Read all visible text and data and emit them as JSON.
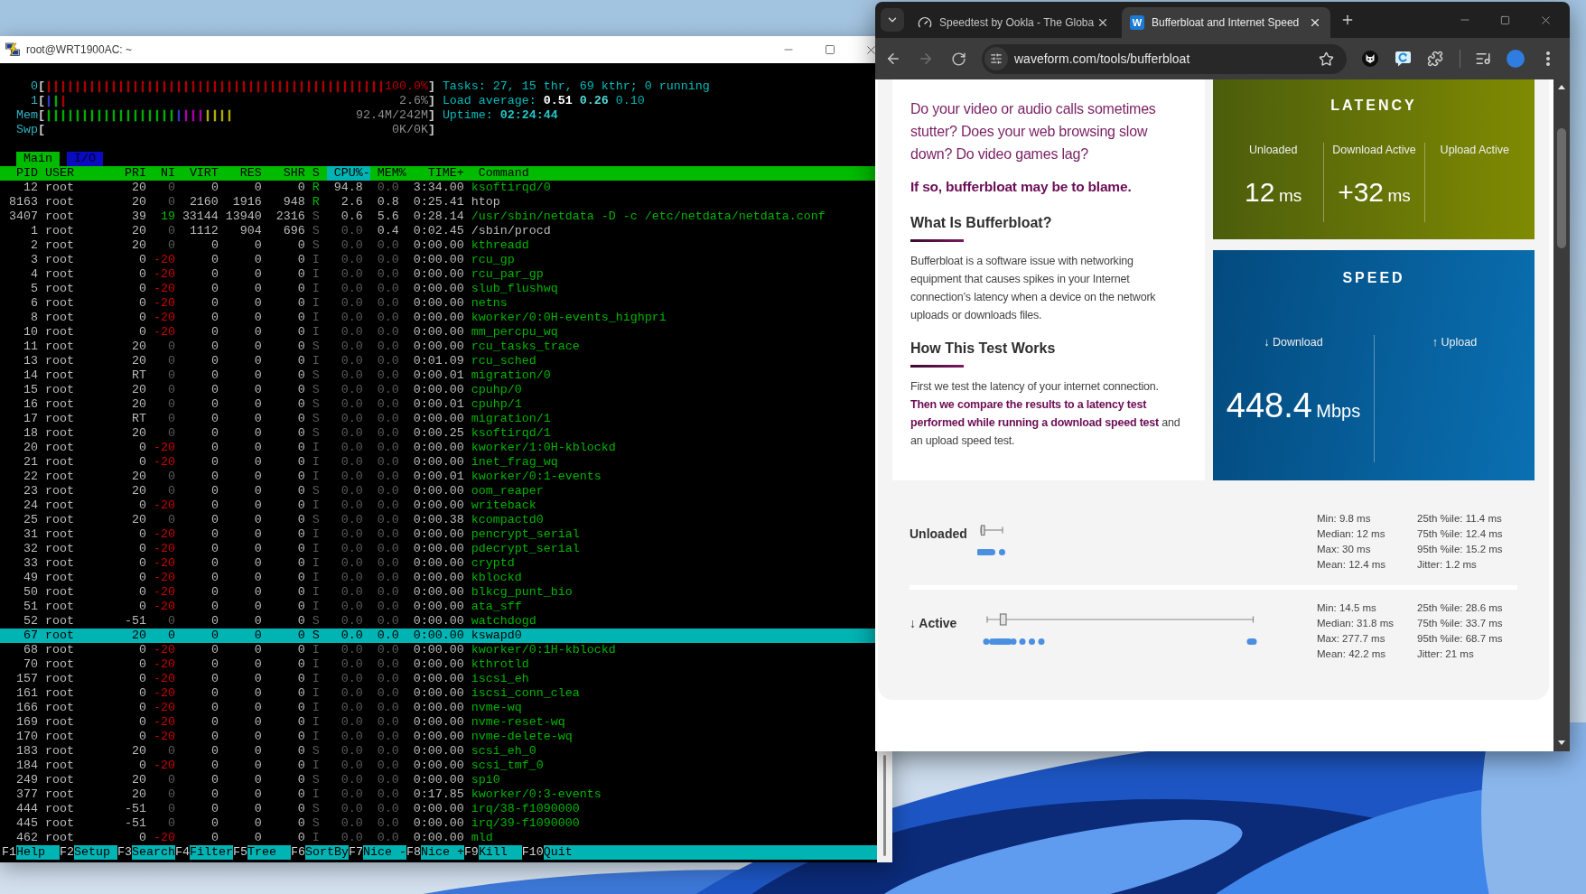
{
  "terminal": {
    "title": "root@WRT1900AC: ~",
    "meters": [
      {
        "label": "0",
        "open": "[",
        "bars": [
          {
            "color": "#bb0000",
            "text": "|||||||||||||||||||||||||||||||||||||||||||||||"
          }
        ],
        "reading": "100.0%",
        "close": "]"
      },
      {
        "label": "1",
        "open": "[",
        "bars": [
          {
            "color": "#3b3bd6",
            "text": "|"
          },
          {
            "color": "#00bb00",
            "text": "|"
          },
          {
            "color": "#bb0000",
            "text": "|"
          }
        ],
        "reading": "2.6%",
        "close": "]"
      },
      {
        "label": "Mem",
        "open": "[",
        "bars": [
          {
            "color": "#00bb00",
            "text": "||||||||||||||||||"
          },
          {
            "color": "#3b3bd6",
            "text": "|"
          },
          {
            "color": "#bb00bb",
            "text": "|||"
          },
          {
            "color": "#bbbb00",
            "text": "||||"
          }
        ],
        "reading": "92.4M/242M",
        "close": "]"
      },
      {
        "label": "Swp",
        "open": "[",
        "reading": "0K/0K",
        "close": "]"
      }
    ],
    "summary": [
      {
        "label": "Tasks:",
        "values": [
          "27, 15 thr, 69 kthr; 0 running"
        ]
      },
      {
        "label": "Load average:",
        "values": [
          "0.51",
          "0.26",
          "0.10"
        ]
      },
      {
        "label": "Uptime:",
        "values": [
          "02:24:44"
        ]
      }
    ],
    "tabs": [
      {
        "label": "Main",
        "selected": true
      },
      {
        "label": "I/O",
        "selected": false
      }
    ],
    "columns": [
      {
        "label": "PID",
        "selected": false
      },
      {
        "label": "USER",
        "selected": false
      },
      {
        "label": "PRI",
        "selected": false
      },
      {
        "label": "NI",
        "selected": false
      },
      {
        "label": "VIRT",
        "selected": false
      },
      {
        "label": "RES",
        "selected": false
      },
      {
        "label": "SHR",
        "selected": false
      },
      {
        "label": "S",
        "selected": false
      },
      {
        "label": "CPU%-",
        "selected": true
      },
      {
        "label": "MEM%",
        "selected": false
      },
      {
        "label": "TIME+",
        "selected": false
      },
      {
        "label": "Command",
        "selected": false
      }
    ],
    "processes": [
      {
        "pid": "12",
        "user": "root",
        "pri": "20",
        "ni": "0",
        "virt": "0",
        "res": "0",
        "shr": "0",
        "state": "R",
        "cpu": "94.8",
        "mem": "0.0",
        "time": "3:34.00",
        "command": "ksoftirqd/0",
        "kind": "thread",
        "running": true,
        "selected": false
      },
      {
        "pid": "8163",
        "user": "root",
        "pri": "20",
        "ni": "0",
        "virt": "2160",
        "res": "1916",
        "shr": "948",
        "state": "R",
        "cpu": "2.6",
        "mem": "0.8",
        "time": "0:25.41",
        "command": "htop",
        "kind": "process",
        "running": true,
        "selected": false
      },
      {
        "pid": "3407",
        "user": "root",
        "pri": "39",
        "ni": "19",
        "virt": "33144",
        "res": "13940",
        "shr": "2316",
        "state": "S",
        "cpu": "0.6",
        "mem": "5.6",
        "time": "0:28.14",
        "command": "/usr/sbin/netdata -D -c /etc/netdata/netdata.conf",
        "kind": "thread",
        "running": false,
        "selected": false
      },
      {
        "pid": "1",
        "user": "root",
        "pri": "20",
        "ni": "0",
        "virt": "1112",
        "res": "904",
        "shr": "696",
        "state": "S",
        "cpu": "0.0",
        "mem": "0.4",
        "time": "0:02.45",
        "command": "/sbin/procd",
        "kind": "process",
        "running": false,
        "selected": false
      },
      {
        "pid": "2",
        "user": "root",
        "pri": "20",
        "ni": "0",
        "virt": "0",
        "res": "0",
        "shr": "0",
        "state": "S",
        "cpu": "0.0",
        "mem": "0.0",
        "time": "0:00.00",
        "command": "kthreadd",
        "kind": "thread",
        "running": false,
        "selected": false
      },
      {
        "pid": "3",
        "user": "root",
        "pri": "0",
        "ni": "-20",
        "virt": "0",
        "res": "0",
        "shr": "0",
        "state": "I",
        "cpu": "0.0",
        "mem": "0.0",
        "time": "0:00.00",
        "command": "rcu_gp",
        "kind": "thread",
        "running": false,
        "selected": false
      },
      {
        "pid": "4",
        "user": "root",
        "pri": "0",
        "ni": "-20",
        "virt": "0",
        "res": "0",
        "shr": "0",
        "state": "I",
        "cpu": "0.0",
        "mem": "0.0",
        "time": "0:00.00",
        "command": "rcu_par_gp",
        "kind": "thread",
        "running": false,
        "selected": false
      },
      {
        "pid": "5",
        "user": "root",
        "pri": "0",
        "ni": "-20",
        "virt": "0",
        "res": "0",
        "shr": "0",
        "state": "I",
        "cpu": "0.0",
        "mem": "0.0",
        "time": "0:00.00",
        "command": "slub_flushwq",
        "kind": "thread",
        "running": false,
        "selected": false
      },
      {
        "pid": "6",
        "user": "root",
        "pri": "0",
        "ni": "-20",
        "virt": "0",
        "res": "0",
        "shr": "0",
        "state": "I",
        "cpu": "0.0",
        "mem": "0.0",
        "time": "0:00.00",
        "command": "netns",
        "kind": "thread",
        "running": false,
        "selected": false
      },
      {
        "pid": "8",
        "user": "root",
        "pri": "0",
        "ni": "-20",
        "virt": "0",
        "res": "0",
        "shr": "0",
        "state": "I",
        "cpu": "0.0",
        "mem": "0.0",
        "time": "0:00.00",
        "command": "kworker/0:0H-events_highpri",
        "kind": "thread",
        "running": false,
        "selected": false
      },
      {
        "pid": "10",
        "user": "root",
        "pri": "0",
        "ni": "-20",
        "virt": "0",
        "res": "0",
        "shr": "0",
        "state": "I",
        "cpu": "0.0",
        "mem": "0.0",
        "time": "0:00.00",
        "command": "mm_percpu_wq",
        "kind": "thread",
        "running": false,
        "selected": false
      },
      {
        "pid": "11",
        "user": "root",
        "pri": "20",
        "ni": "0",
        "virt": "0",
        "res": "0",
        "shr": "0",
        "state": "S",
        "cpu": "0.0",
        "mem": "0.0",
        "time": "0:00.00",
        "command": "rcu_tasks_trace",
        "kind": "thread",
        "running": false,
        "selected": false
      },
      {
        "pid": "13",
        "user": "root",
        "pri": "20",
        "ni": "0",
        "virt": "0",
        "res": "0",
        "shr": "0",
        "state": "I",
        "cpu": "0.0",
        "mem": "0.0",
        "time": "0:01.09",
        "command": "rcu_sched",
        "kind": "thread",
        "running": false,
        "selected": false
      },
      {
        "pid": "14",
        "user": "root",
        "pri": "RT",
        "ni": "0",
        "virt": "0",
        "res": "0",
        "shr": "0",
        "state": "S",
        "cpu": "0.0",
        "mem": "0.0",
        "time": "0:00.01",
        "command": "migration/0",
        "kind": "thread",
        "running": false,
        "selected": false
      },
      {
        "pid": "15",
        "user": "root",
        "pri": "20",
        "ni": "0",
        "virt": "0",
        "res": "0",
        "shr": "0",
        "state": "S",
        "cpu": "0.0",
        "mem": "0.0",
        "time": "0:00.00",
        "command": "cpuhp/0",
        "kind": "thread",
        "running": false,
        "selected": false
      },
      {
        "pid": "16",
        "user": "root",
        "pri": "20",
        "ni": "0",
        "virt": "0",
        "res": "0",
        "shr": "0",
        "state": "S",
        "cpu": "0.0",
        "mem": "0.0",
        "time": "0:00.01",
        "command": "cpuhp/1",
        "kind": "thread",
        "running": false,
        "selected": false
      },
      {
        "pid": "17",
        "user": "root",
        "pri": "RT",
        "ni": "0",
        "virt": "0",
        "res": "0",
        "shr": "0",
        "state": "S",
        "cpu": "0.0",
        "mem": "0.0",
        "time": "0:00.00",
        "command": "migration/1",
        "kind": "thread",
        "running": false,
        "selected": false
      },
      {
        "pid": "18",
        "user": "root",
        "pri": "20",
        "ni": "0",
        "virt": "0",
        "res": "0",
        "shr": "0",
        "state": "S",
        "cpu": "0.0",
        "mem": "0.0",
        "time": "0:00.25",
        "command": "ksoftirqd/1",
        "kind": "thread",
        "running": false,
        "selected": false
      },
      {
        "pid": "20",
        "user": "root",
        "pri": "0",
        "ni": "-20",
        "virt": "0",
        "res": "0",
        "shr": "0",
        "state": "I",
        "cpu": "0.0",
        "mem": "0.0",
        "time": "0:00.00",
        "command": "kworker/1:0H-kblockd",
        "kind": "thread",
        "running": false,
        "selected": false
      },
      {
        "pid": "21",
        "user": "root",
        "pri": "0",
        "ni": "-20",
        "virt": "0",
        "res": "0",
        "shr": "0",
        "state": "I",
        "cpu": "0.0",
        "mem": "0.0",
        "time": "0:00.00",
        "command": "inet_frag_wq",
        "kind": "thread",
        "running": false,
        "selected": false
      },
      {
        "pid": "22",
        "user": "root",
        "pri": "20",
        "ni": "0",
        "virt": "0",
        "res": "0",
        "shr": "0",
        "state": "I",
        "cpu": "0.0",
        "mem": "0.0",
        "time": "0:00.01",
        "command": "kworker/0:1-events",
        "kind": "thread",
        "running": false,
        "selected": false
      },
      {
        "pid": "23",
        "user": "root",
        "pri": "20",
        "ni": "0",
        "virt": "0",
        "res": "0",
        "shr": "0",
        "state": "S",
        "cpu": "0.0",
        "mem": "0.0",
        "time": "0:00.00",
        "command": "oom_reaper",
        "kind": "thread",
        "running": false,
        "selected": false
      },
      {
        "pid": "24",
        "user": "root",
        "pri": "0",
        "ni": "-20",
        "virt": "0",
        "res": "0",
        "shr": "0",
        "state": "I",
        "cpu": "0.0",
        "mem": "0.0",
        "time": "0:00.00",
        "command": "writeback",
        "kind": "thread",
        "running": false,
        "selected": false
      },
      {
        "pid": "25",
        "user": "root",
        "pri": "20",
        "ni": "0",
        "virt": "0",
        "res": "0",
        "shr": "0",
        "state": "S",
        "cpu": "0.0",
        "mem": "0.0",
        "time": "0:00.38",
        "command": "kcompactd0",
        "kind": "thread",
        "running": false,
        "selected": false
      },
      {
        "pid": "31",
        "user": "root",
        "pri": "0",
        "ni": "-20",
        "virt": "0",
        "res": "0",
        "shr": "0",
        "state": "I",
        "cpu": "0.0",
        "mem": "0.0",
        "time": "0:00.00",
        "command": "pencrypt_serial",
        "kind": "thread",
        "running": false,
        "selected": false
      },
      {
        "pid": "32",
        "user": "root",
        "pri": "0",
        "ni": "-20",
        "virt": "0",
        "res": "0",
        "shr": "0",
        "state": "I",
        "cpu": "0.0",
        "mem": "0.0",
        "time": "0:00.00",
        "command": "pdecrypt_serial",
        "kind": "thread",
        "running": false,
        "selected": false
      },
      {
        "pid": "33",
        "user": "root",
        "pri": "0",
        "ni": "-20",
        "virt": "0",
        "res": "0",
        "shr": "0",
        "state": "I",
        "cpu": "0.0",
        "mem": "0.0",
        "time": "0:00.00",
        "command": "cryptd",
        "kind": "thread",
        "running": false,
        "selected": false
      },
      {
        "pid": "49",
        "user": "root",
        "pri": "0",
        "ni": "-20",
        "virt": "0",
        "res": "0",
        "shr": "0",
        "state": "I",
        "cpu": "0.0",
        "mem": "0.0",
        "time": "0:00.00",
        "command": "kblockd",
        "kind": "thread",
        "running": false,
        "selected": false
      },
      {
        "pid": "50",
        "user": "root",
        "pri": "0",
        "ni": "-20",
        "virt": "0",
        "res": "0",
        "shr": "0",
        "state": "I",
        "cpu": "0.0",
        "mem": "0.0",
        "time": "0:00.00",
        "command": "blkcg_punt_bio",
        "kind": "thread",
        "running": false,
        "selected": false
      },
      {
        "pid": "51",
        "user": "root",
        "pri": "0",
        "ni": "-20",
        "virt": "0",
        "res": "0",
        "shr": "0",
        "state": "I",
        "cpu": "0.0",
        "mem": "0.0",
        "time": "0:00.00",
        "command": "ata_sff",
        "kind": "thread",
        "running": false,
        "selected": false
      },
      {
        "pid": "52",
        "user": "root",
        "pri": "-51",
        "ni": "0",
        "virt": "0",
        "res": "0",
        "shr": "0",
        "state": "S",
        "cpu": "0.0",
        "mem": "0.0",
        "time": "0:00.00",
        "command": "watchdogd",
        "kind": "thread",
        "running": false,
        "selected": false
      },
      {
        "pid": "67",
        "user": "root",
        "pri": "20",
        "ni": "0",
        "virt": "0",
        "res": "0",
        "shr": "0",
        "state": "S",
        "cpu": "0.0",
        "mem": "0.0",
        "time": "0:00.00",
        "command": "kswapd0",
        "kind": "thread",
        "running": false,
        "selected": true
      },
      {
        "pid": "68",
        "user": "root",
        "pri": "0",
        "ni": "-20",
        "virt": "0",
        "res": "0",
        "shr": "0",
        "state": "I",
        "cpu": "0.0",
        "mem": "0.0",
        "time": "0:00.00",
        "command": "kworker/0:1H-kblockd",
        "kind": "thread",
        "running": false,
        "selected": false
      },
      {
        "pid": "70",
        "user": "root",
        "pri": "0",
        "ni": "-20",
        "virt": "0",
        "res": "0",
        "shr": "0",
        "state": "I",
        "cpu": "0.0",
        "mem": "0.0",
        "time": "0:00.00",
        "command": "kthrotld",
        "kind": "thread",
        "running": false,
        "selected": false
      },
      {
        "pid": "157",
        "user": "root",
        "pri": "0",
        "ni": "-20",
        "virt": "0",
        "res": "0",
        "shr": "0",
        "state": "I",
        "cpu": "0.0",
        "mem": "0.0",
        "time": "0:00.00",
        "command": "iscsi_eh",
        "kind": "thread",
        "running": false,
        "selected": false
      },
      {
        "pid": "161",
        "user": "root",
        "pri": "0",
        "ni": "-20",
        "virt": "0",
        "res": "0",
        "shr": "0",
        "state": "I",
        "cpu": "0.0",
        "mem": "0.0",
        "time": "0:00.00",
        "command": "iscsi_conn_clea",
        "kind": "thread",
        "running": false,
        "selected": false
      },
      {
        "pid": "166",
        "user": "root",
        "pri": "0",
        "ni": "-20",
        "virt": "0",
        "res": "0",
        "shr": "0",
        "state": "I",
        "cpu": "0.0",
        "mem": "0.0",
        "time": "0:00.00",
        "command": "nvme-wq",
        "kind": "thread",
        "running": false,
        "selected": false
      },
      {
        "pid": "169",
        "user": "root",
        "pri": "0",
        "ni": "-20",
        "virt": "0",
        "res": "0",
        "shr": "0",
        "state": "I",
        "cpu": "0.0",
        "mem": "0.0",
        "time": "0:00.00",
        "command": "nvme-reset-wq",
        "kind": "thread",
        "running": false,
        "selected": false
      },
      {
        "pid": "170",
        "user": "root",
        "pri": "0",
        "ni": "-20",
        "virt": "0",
        "res": "0",
        "shr": "0",
        "state": "I",
        "cpu": "0.0",
        "mem": "0.0",
        "time": "0:00.00",
        "command": "nvme-delete-wq",
        "kind": "thread",
        "running": false,
        "selected": false
      },
      {
        "pid": "183",
        "user": "root",
        "pri": "20",
        "ni": "0",
        "virt": "0",
        "res": "0",
        "shr": "0",
        "state": "S",
        "cpu": "0.0",
        "mem": "0.0",
        "time": "0:00.00",
        "command": "scsi_eh_0",
        "kind": "thread",
        "running": false,
        "selected": false
      },
      {
        "pid": "184",
        "user": "root",
        "pri": "0",
        "ni": "-20",
        "virt": "0",
        "res": "0",
        "shr": "0",
        "state": "I",
        "cpu": "0.0",
        "mem": "0.0",
        "time": "0:00.00",
        "command": "scsi_tmf_0",
        "kind": "thread",
        "running": false,
        "selected": false
      },
      {
        "pid": "249",
        "user": "root",
        "pri": "20",
        "ni": "0",
        "virt": "0",
        "res": "0",
        "shr": "0",
        "state": "S",
        "cpu": "0.0",
        "mem": "0.0",
        "time": "0:00.00",
        "command": "spi0",
        "kind": "thread",
        "running": false,
        "selected": false
      },
      {
        "pid": "377",
        "user": "root",
        "pri": "20",
        "ni": "0",
        "virt": "0",
        "res": "0",
        "shr": "0",
        "state": "I",
        "cpu": "0.0",
        "mem": "0.0",
        "time": "0:17.85",
        "command": "kworker/0:3-events",
        "kind": "thread",
        "running": false,
        "selected": false
      },
      {
        "pid": "444",
        "user": "root",
        "pri": "-51",
        "ni": "0",
        "virt": "0",
        "res": "0",
        "shr": "0",
        "state": "S",
        "cpu": "0.0",
        "mem": "0.0",
        "time": "0:00.00",
        "command": "irq/38-f1090000",
        "kind": "thread",
        "running": false,
        "selected": false
      },
      {
        "pid": "445",
        "user": "root",
        "pri": "-51",
        "ni": "0",
        "virt": "0",
        "res": "0",
        "shr": "0",
        "state": "S",
        "cpu": "0.0",
        "mem": "0.0",
        "time": "0:00.00",
        "command": "irq/39-f1090000",
        "kind": "thread",
        "running": false,
        "selected": false
      },
      {
        "pid": "462",
        "user": "root",
        "pri": "0",
        "ni": "-20",
        "virt": "0",
        "res": "0",
        "shr": "0",
        "state": "I",
        "cpu": "0.0",
        "mem": "0.0",
        "time": "0:00.00",
        "command": "mld",
        "kind": "thread",
        "running": false,
        "selected": false
      }
    ],
    "function_keys": [
      {
        "key": "F1",
        "label": "Help"
      },
      {
        "key": "F2",
        "label": "Setup"
      },
      {
        "key": "F3",
        "label": "Search"
      },
      {
        "key": "F4",
        "label": "Filter"
      },
      {
        "key": "F5",
        "label": "Tree"
      },
      {
        "key": "F6",
        "label": "SortBy"
      },
      {
        "key": "F7",
        "label": "Nice -"
      },
      {
        "key": "F8",
        "label": "Nice +"
      },
      {
        "key": "F9",
        "label": "Kill"
      },
      {
        "key": "F10",
        "label": "Quit"
      }
    ]
  },
  "browser": {
    "tabs": [
      {
        "title": "Speedtest by Ookla - The Globa",
        "selected": false
      },
      {
        "title": "Bufferbloat and Internet Speed",
        "favicon_text": "W",
        "selected": true
      }
    ],
    "url": "waveform.com/tools/bufferbloat",
    "page": {
      "intro": "Do your video or audio calls sometimes stutter? Does your web browsing slow down? Do video games lag?",
      "callout": "If so, bufferbloat may be to blame.",
      "sections": [
        {
          "heading": "What Is Bufferbloat?",
          "body": "Bufferbloat is a software issue with networking equipment that causes spikes in your Internet connection’s latency when a device on the network uploads or downloads files."
        },
        {
          "heading": "How This Test Works",
          "body": "First we test the latency of your internet connection. **Then we compare the results to a latency test performed while running a download speed test** and an upload speed test."
        }
      ],
      "latency": {
        "title": "LATENCY",
        "columns": [
          {
            "label": "Unloaded",
            "value": "12",
            "unit": "ms"
          },
          {
            "label": "Download Active",
            "value": "+32",
            "unit": "ms"
          },
          {
            "label": "Upload Active"
          }
        ]
      },
      "speed": {
        "title": "SPEED",
        "columns": [
          {
            "label": "↓ Download",
            "value": "448.4",
            "unit": "Mbps"
          },
          {
            "label": "↑ Upload"
          }
        ]
      },
      "results": [
        {
          "label": "Unloaded",
          "stats": [
            [
              "Min: 9.8 ms",
              "Median: 12 ms",
              "Max: 30 ms",
              "Mean: 12.4 ms"
            ],
            [
              "25th %ile: 11.4 ms",
              "75th %ile: 12.4 ms",
              "95th %ile: 15.2 ms",
              "Jitter: 1.2 ms"
            ]
          ]
        },
        {
          "label": "↓ Active",
          "stats": [
            [
              "Min: 14.5 ms",
              "Median: 31.8 ms",
              "Max: 277.7 ms",
              "Mean: 42.2 ms"
            ],
            [
              "25th %ile: 28.6 ms",
              "75th %ile: 33.7 ms",
              "95th %ile: 68.7 ms",
              "Jitter: 21 ms"
            ]
          ]
        }
      ]
    }
  }
}
